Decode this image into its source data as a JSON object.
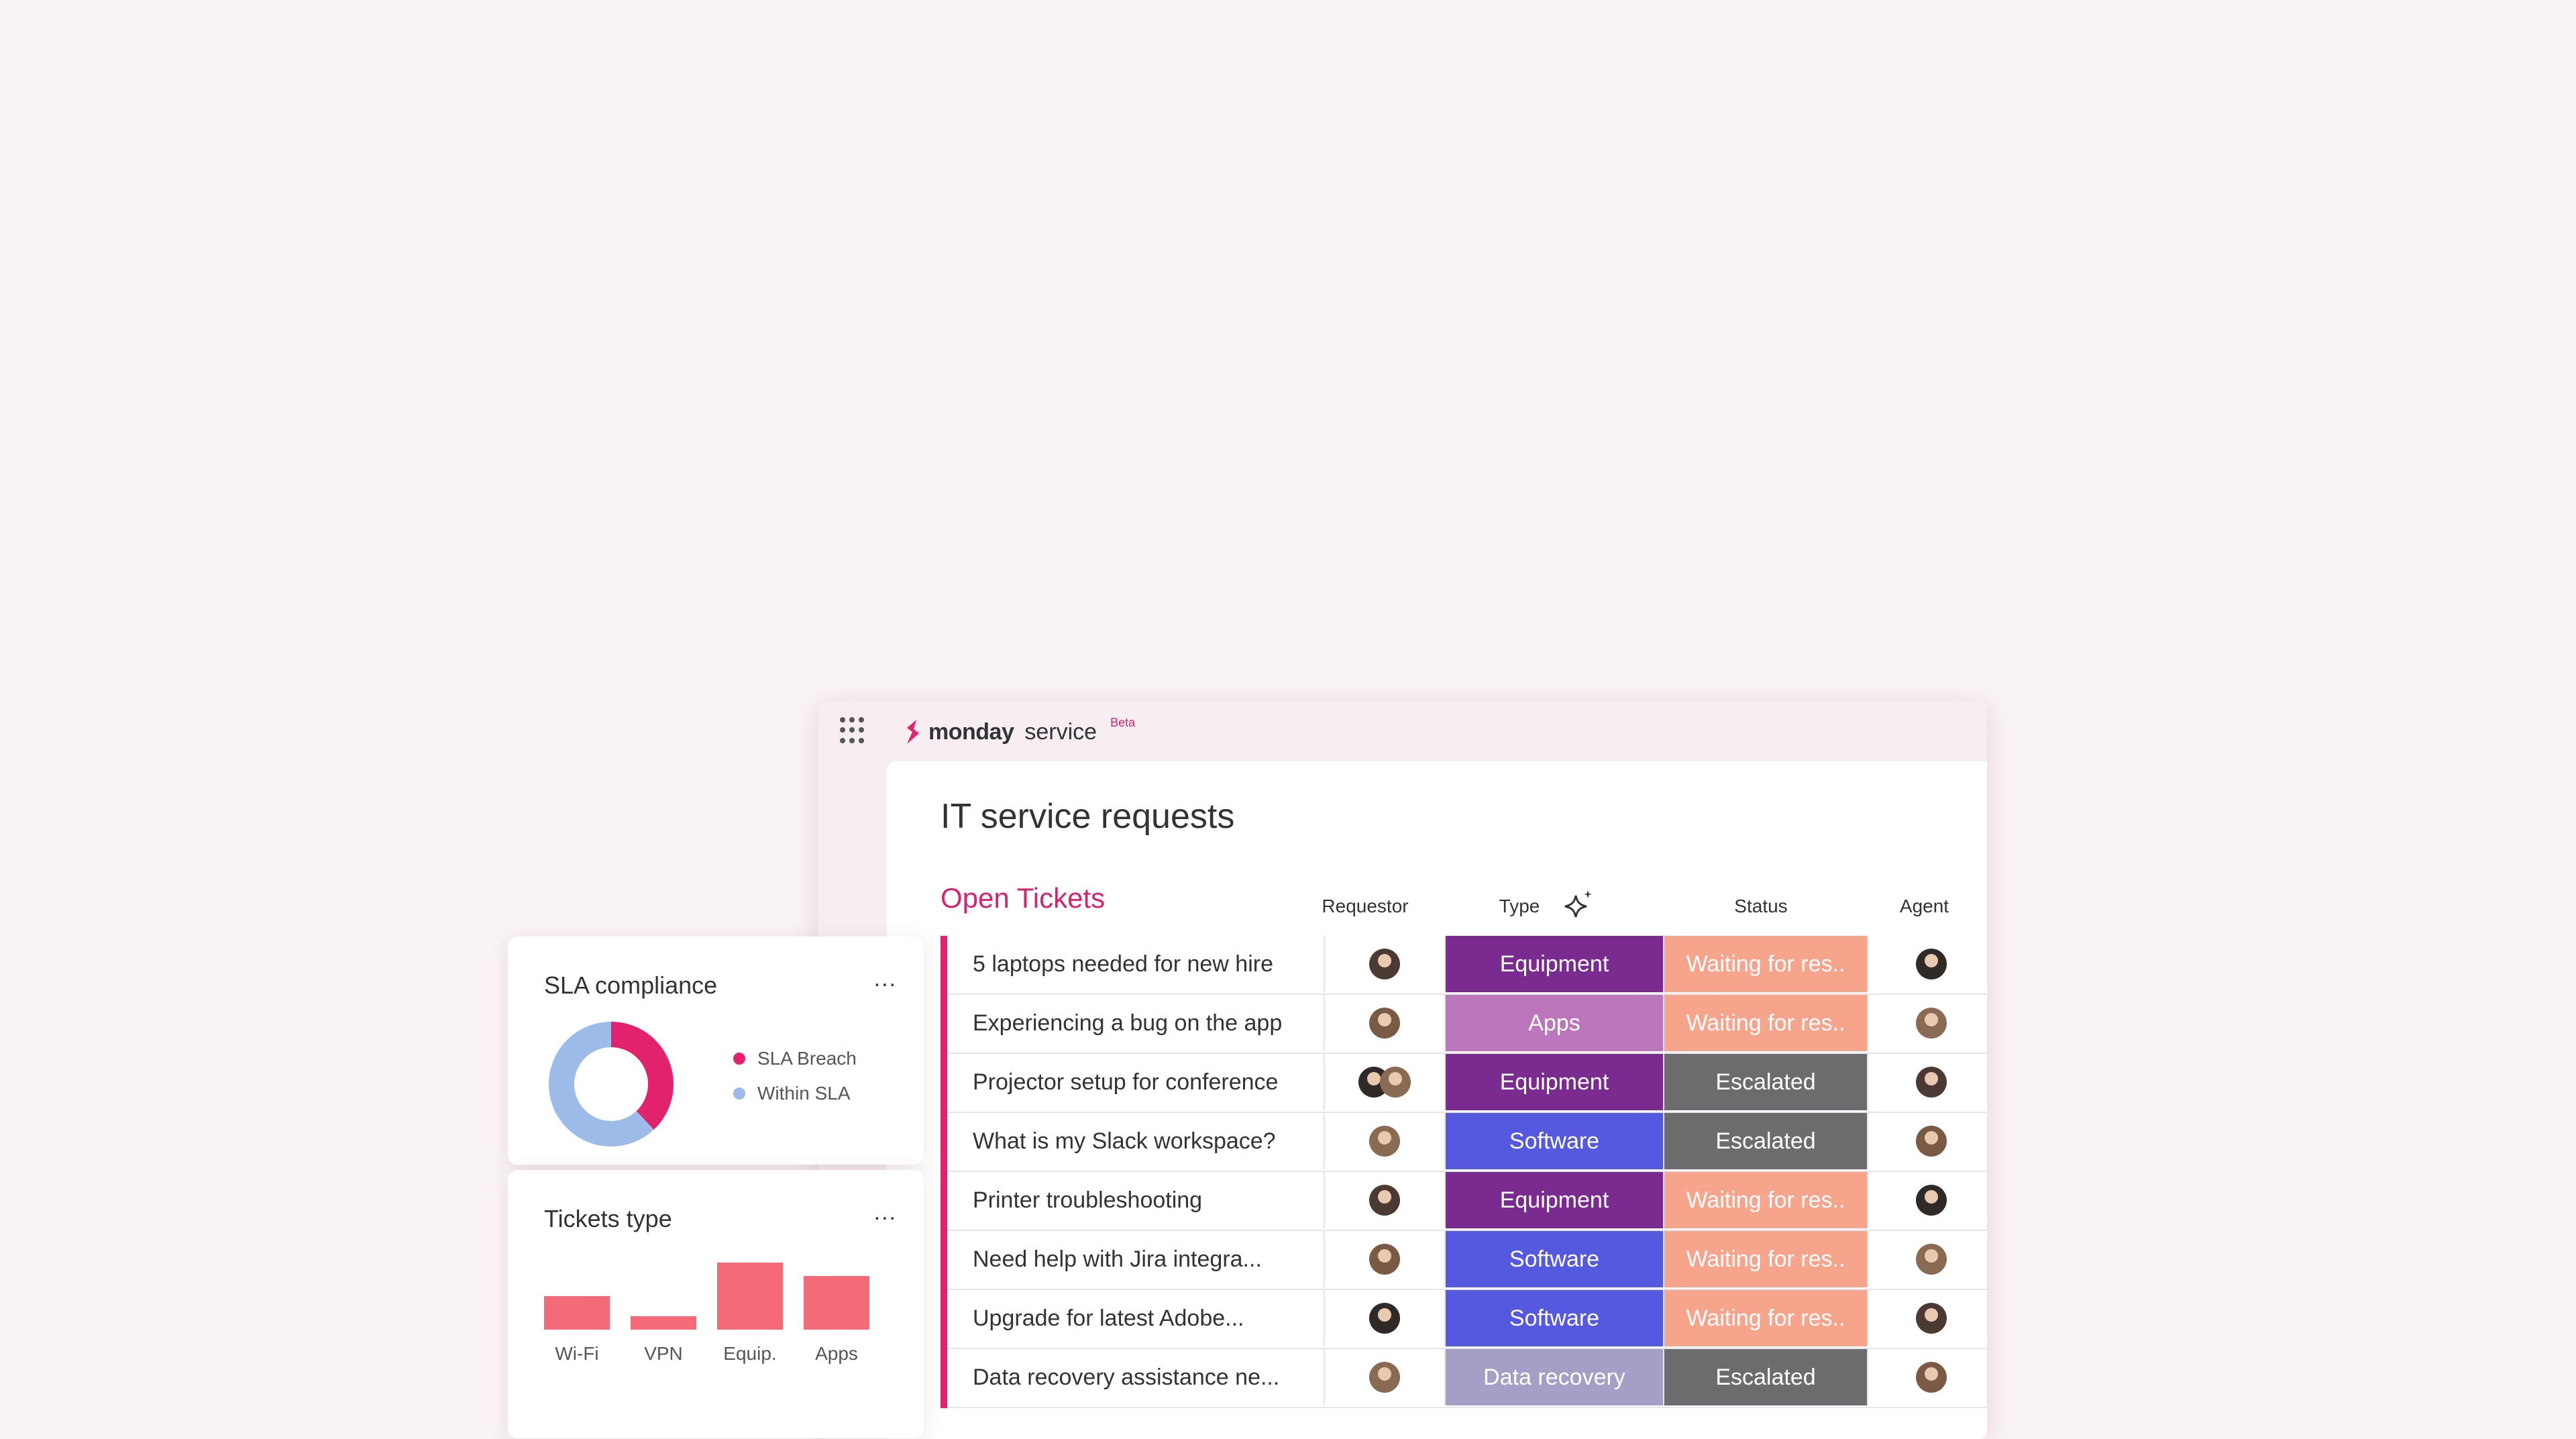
{
  "app": {
    "brand": "monday",
    "product": "service",
    "badge": "Beta"
  },
  "page": {
    "title": "IT service requests",
    "group_title": "Open Tickets"
  },
  "columns": {
    "requestor": "Requestor",
    "type": "Type",
    "status": "Status",
    "agent": "Agent"
  },
  "tickets": [
    {
      "name": "5 laptops needed for new hire",
      "type": "Equipment",
      "status": "Waiting for res..",
      "requestors": 1
    },
    {
      "name": "Experiencing a bug on the app",
      "type": "Apps",
      "status": "Waiting for res..",
      "requestors": 1
    },
    {
      "name": "Projector setup for conference",
      "type": "Equipment",
      "status": "Escalated",
      "requestors": 2
    },
    {
      "name": "What is my Slack workspace?",
      "type": "Software",
      "status": "Escalated",
      "requestors": 1
    },
    {
      "name": "Printer troubleshooting",
      "type": "Equipment",
      "status": "Waiting for res..",
      "requestors": 1
    },
    {
      "name": "Need help with Jira integra...",
      "type": "Software",
      "status": "Waiting for res..",
      "requestors": 1
    },
    {
      "name": "Upgrade for latest Adobe...",
      "type": "Software",
      "status": "Waiting for res..",
      "requestors": 1
    },
    {
      "name": "Data recovery assistance ne...",
      "type": "Data recovery",
      "status": "Escalated",
      "requestors": 1
    }
  ],
  "colors": {
    "accent": "#e2226b",
    "type": {
      "Equipment": "#7a2b8f",
      "Apps": "#bb76bc",
      "Software": "#5559df",
      "Data recovery": "#a49fc6"
    },
    "status": {
      "Waiting for res..": "#f6a48c",
      "Escalated": "#6c6c6f"
    }
  },
  "sla_widget": {
    "title": "SLA compliance",
    "more": "...",
    "legend": [
      {
        "label": "SLA Breach",
        "color": "#e2226b"
      },
      {
        "label": "Within SLA",
        "color": "#9dbbe8"
      }
    ],
    "chart_data": {
      "type": "pie",
      "categories": [
        "SLA Breach",
        "Within SLA"
      ],
      "values": [
        38,
        62
      ]
    }
  },
  "types_widget": {
    "title": "Tickets type",
    "more": "...",
    "chart_data": {
      "type": "bar",
      "categories": [
        "Wi-Fi",
        "VPN",
        "Equip.",
        "Apps"
      ],
      "values": [
        20,
        8,
        40,
        32
      ],
      "color": "#f46a78"
    }
  }
}
